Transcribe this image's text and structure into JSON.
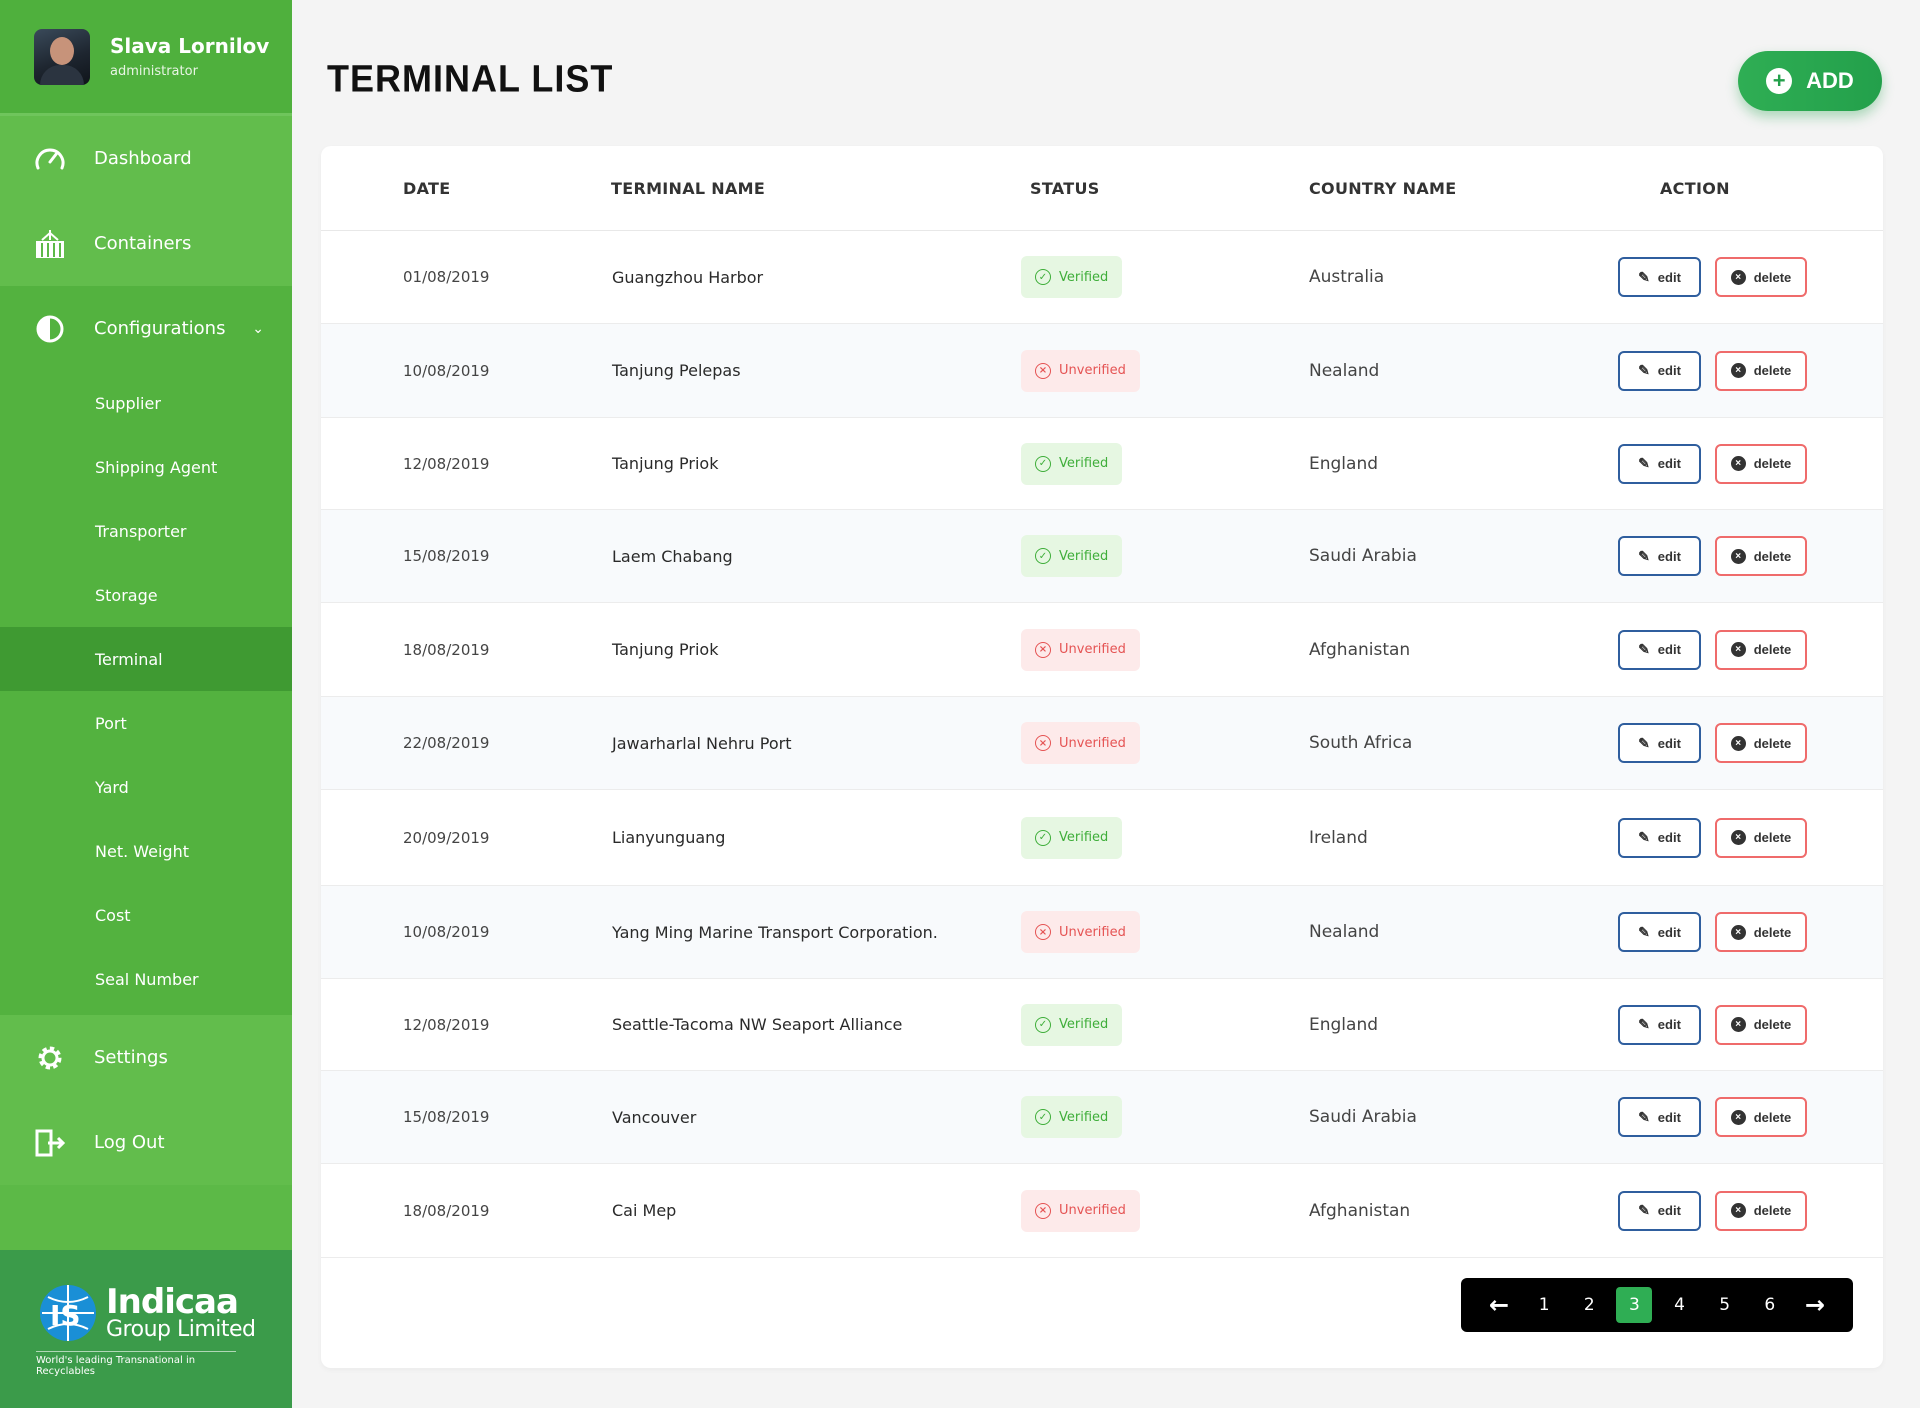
{
  "profile": {
    "name": "Slava Lornilov",
    "role": "administrator"
  },
  "nav": {
    "dashboard": "Dashboard",
    "containers": "Containers",
    "configurations": "Configurations",
    "settings": "Settings",
    "logout": "Log Out",
    "submenu": [
      "Supplier",
      "Shipping Agent",
      "Transporter",
      "Storage",
      "Terminal",
      "Port",
      "Yard",
      "Net. Weight",
      "Cost",
      "Seal Number"
    ],
    "active_submenu": "Terminal"
  },
  "logo": {
    "title": "Indicaa",
    "subtitle": "Group Limited",
    "tagline": "World's leading Transnational in Recyclables"
  },
  "page": {
    "title": "TERMINAL LIST",
    "add_label": "ADD"
  },
  "table": {
    "headers": {
      "date": "DATE",
      "terminal": "TERMINAL NAME",
      "status": "STATUS",
      "country": "COUNTRY NAME",
      "action": "ACTION"
    },
    "edit_label": "edit",
    "delete_label": "delete",
    "rows": [
      {
        "date": "01/08/2019",
        "terminal": "Guangzhou Harbor",
        "status": "Verified",
        "country": "Australia"
      },
      {
        "date": "10/08/2019",
        "terminal": "Tanjung Pelepas",
        "status": "Unverified",
        "country": "Nealand"
      },
      {
        "date": "12/08/2019",
        "terminal": "Tanjung Priok",
        "status": "Verified",
        "country": "England"
      },
      {
        "date": "15/08/2019",
        "terminal": "Laem Chabang",
        "status": "Verified",
        "country": "Saudi Arabia"
      },
      {
        "date": "18/08/2019",
        "terminal": "Tanjung Priok",
        "status": "Unverified",
        "country": "Afghanistan"
      },
      {
        "date": "22/08/2019",
        "terminal": "Jawarharlal Nehru Port",
        "status": "Unverified",
        "country": "South Africa"
      },
      {
        "date": "20/09/2019",
        "terminal": "Lianyunguang",
        "status": "Verified",
        "country": "Ireland"
      },
      {
        "date": "10/08/2019",
        "terminal": "Yang Ming Marine Transport Corporation.",
        "status": "Unverified",
        "country": "Nealand"
      },
      {
        "date": "12/08/2019",
        "terminal": "Seattle-Tacoma NW Seaport Alliance",
        "status": "Verified",
        "country": "England"
      },
      {
        "date": "15/08/2019",
        "terminal": "Vancouver",
        "status": "Verified",
        "country": "Saudi Arabia"
      },
      {
        "date": "18/08/2019",
        "terminal": "Cai Mep",
        "status": "Unverified",
        "country": "Afghanistan"
      }
    ]
  },
  "pagination": {
    "pages": [
      "1",
      "2",
      "3",
      "4",
      "5",
      "6"
    ],
    "current": "3"
  },
  "colors": {
    "sidebar": "#5cb947",
    "accent": "#2fae54",
    "verified": "#3fae3a",
    "unverified": "#e55353",
    "edit_border": "#2f5e9e"
  }
}
